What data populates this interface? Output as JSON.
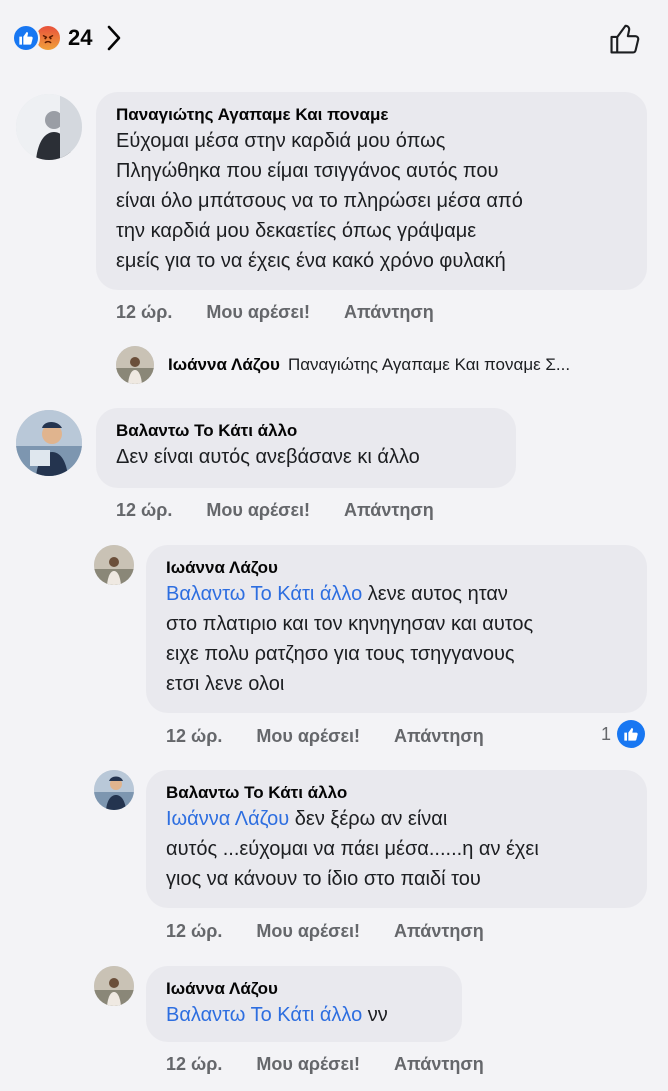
{
  "header": {
    "reaction_icons": [
      "like-icon",
      "angry-icon"
    ],
    "reaction_count": "24",
    "chevron": "chevron-right-icon",
    "like_action_icon": "thumbs-up-outline-icon"
  },
  "comments": [
    {
      "author": "Παναγιώτης Αγαπαμε Και ποναμε",
      "lines": [
        "Εύχομαι μέσα στην καρδιά μου όπως",
        "Πληγώθηκα που είμαι τσιγγάνος αυτός που",
        "είναι όλο μπάτσους να το πληρώσει μέσα από",
        "την καρδιά μου δεκαετίες όπως γράψαμε",
        "εμείς για το να έχεις ένα κακό χρόνο φυλακή"
      ],
      "time": "12 ώρ.",
      "like": "Μου αρέσει!",
      "reply": "Απάντηση"
    },
    {
      "author": "Βαλαντω Το Κάτι άλλο",
      "lines": [
        "Δεν είναι αυτός ανεβάσανε κι άλλο"
      ],
      "time": "12 ώρ.",
      "like": "Μου αρέσει!",
      "reply": "Απάντηση"
    }
  ],
  "collapsed_reply": {
    "author": "Ιωάννα Λάζου",
    "text": "Παναγιώτης Αγαπαμε Και  ποναμε Σ..."
  },
  "replies": [
    {
      "author": "Ιωάννα Λάζου",
      "mention": "Βαλαντω Το Κάτι άλλο",
      "line1_rest": " λενε αυτος ηταν",
      "lines": [
        "στο πλατιριο και τον κηνηγησαν και αυτος",
        "ειχε πολυ ρατζησο για τους τσηγγανους",
        "ετσι λενε ολοι"
      ],
      "time": "12 ώρ.",
      "like": "Μου αρέσει!",
      "reply": "Απάντηση",
      "like_count": "1"
    },
    {
      "author": "Βαλαντω Το Κάτι άλλο",
      "mention": "Ιωάννα Λάζου",
      "line1_rest": " δεν ξέρω αν είναι",
      "lines": [
        "αυτός ...εύχομαι να πάει μέσα......η αν έχει",
        "γιος να κάνουν το ίδιο στο παιδί του"
      ],
      "time": "12 ώρ.",
      "like": "Μου αρέσει!",
      "reply": "Απάντηση"
    },
    {
      "author": "Ιωάννα Λάζου",
      "mention": "Βαλαντω Το Κάτι άλλο",
      "line1_rest": " νν",
      "lines": [],
      "time": "12 ώρ.",
      "like": "Μου αρέσει!",
      "reply": "Απάντηση"
    }
  ],
  "colors": {
    "background": "#f3f3f6",
    "bubble": "#e9e9ee",
    "mention": "#2d6ee0",
    "like_blue": "#1877f2",
    "meta_gray": "#65676b"
  }
}
